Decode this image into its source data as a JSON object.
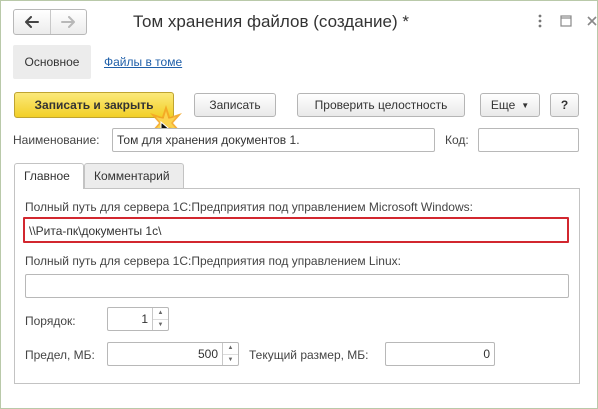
{
  "window": {
    "title": "Том хранения файлов (создание) *",
    "nav": {
      "back_icon": "arrow-left-icon",
      "forward_icon": "arrow-right-icon"
    },
    "icons": [
      "more-icon",
      "maximize-icon",
      "close-icon"
    ]
  },
  "sections": {
    "main": "Основное",
    "files": "Файлы в томе"
  },
  "toolbar": {
    "save_close": "Записать и закрыть",
    "save": "Записать",
    "check_integrity": "Проверить целостность",
    "more": "Еще",
    "help": "?"
  },
  "form": {
    "name_label": "Наименование:",
    "name_value": "Том для хранения документов 1.",
    "code_label": "Код:",
    "code_value": ""
  },
  "tabs": {
    "main": "Главное",
    "comment": "Комментарий"
  },
  "main_tab": {
    "windows_label": "Полный путь для сервера 1С:Предприятия под управлением Microsoft Windows:",
    "windows_value": "\\\\Рита-пк\\документы 1с\\",
    "linux_label": "Полный путь для сервера 1С:Предприятия под управлением Linux:",
    "linux_value": "",
    "order_label": "Порядок:",
    "order_value": "1",
    "limit_label": "Предел, МБ:",
    "limit_value": "500",
    "current_size_label": "Текущий размер, МБ:",
    "current_size_value": "0"
  },
  "colors": {
    "primary_button": "#f2cf27",
    "highlight_border": "#d2272f",
    "link": "#1f5fa9"
  }
}
